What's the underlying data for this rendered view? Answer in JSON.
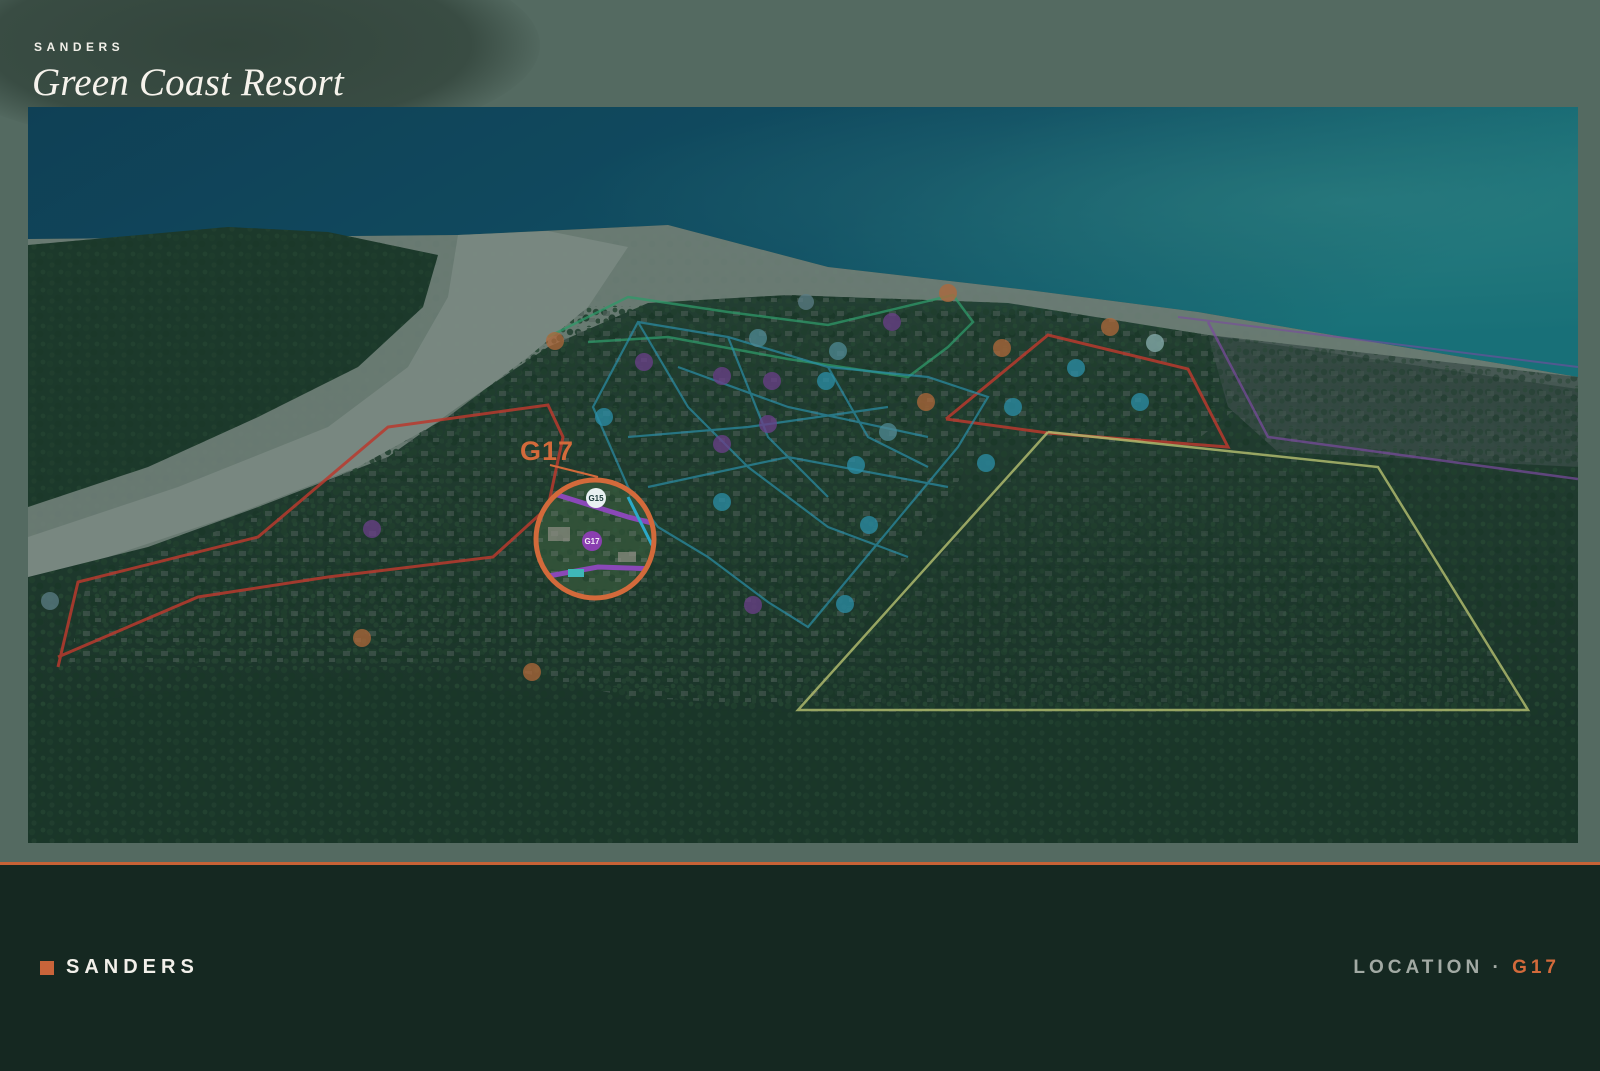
{
  "header": {
    "brand": "SANDERS",
    "title": "Green Coast Resort"
  },
  "map": {
    "highlight": {
      "label": "G17",
      "inset_labels": [
        "G15",
        "G17"
      ],
      "color": "#d36a3b"
    },
    "zones": [
      {
        "name": "red-zone-west",
        "color": "#b8392e"
      },
      {
        "name": "red-zone-east",
        "color": "#b8392e"
      },
      {
        "name": "teal-road-network",
        "color": "#2b8fa8"
      },
      {
        "name": "green-zone-north",
        "color": "#2f9a6a"
      },
      {
        "name": "olive-zone-east",
        "color": "#b7c070"
      },
      {
        "name": "purple-road",
        "color": "#7a4aa0"
      }
    ],
    "colors": {
      "sea_deep": "#0e4d6e",
      "sea_light": "#1a7a8c",
      "sand": "#9eaaa1",
      "forest": "#1e3d2c"
    }
  },
  "footer": {
    "brand": "SANDERS",
    "location_label": "LOCATION",
    "separator": "·",
    "location_code": "G17",
    "accent_color": "#c9643a"
  }
}
